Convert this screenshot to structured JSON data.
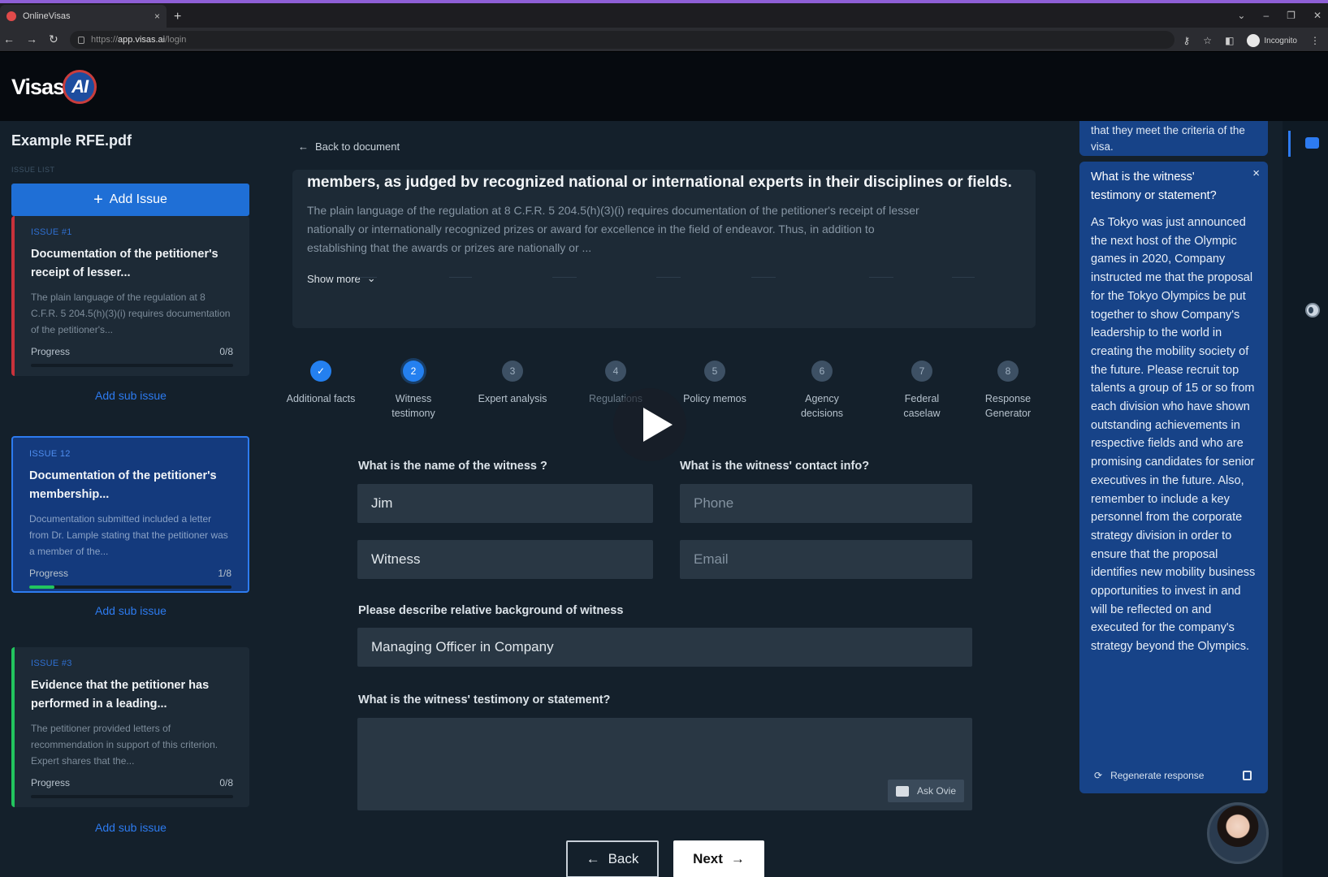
{
  "browser": {
    "tab_title": "OnlineVisas",
    "tab_close": "×",
    "new_tab": "+",
    "url_prefix": "https://",
    "url_host": "app.visas.ai",
    "url_path": "/login",
    "incognito_label": "Incognito"
  },
  "app": {
    "logo_text": "Visas",
    "logo_badge": "AI"
  },
  "sidebar": {
    "doc_name": "Example RFE.pdf",
    "issue_list_label": "ISSUE LIST",
    "add_issue_label": "Add Issue",
    "add_sub_issue_label": "Add sub issue",
    "issues": [
      {
        "label": "ISSUE #1",
        "title": "Documentation of the petitioner's receipt of lesser...",
        "desc": "The plain language of the regulation at 8 C.F.R. 5 204.5(h)(3)(i) requires documentation of the petitioner's...",
        "progress_label": "Progress",
        "progress_value": "0/8",
        "progress_fraction": 0
      },
      {
        "label": "ISSUE 12",
        "title": "Documentation of the petitioner's membership...",
        "desc": "Documentation submitted included a letter from Dr. Lample stating that the petitioner was a member of the...",
        "progress_label": "Progress",
        "progress_value": "1/8",
        "progress_fraction": 0.125
      },
      {
        "label": "ISSUE #3",
        "title": "Evidence that the petitioner has performed in a leading...",
        "desc": "The petitioner provided letters of recommendation in support of this criterion. Expert shares that the...",
        "progress_label": "Progress",
        "progress_value": "0/8",
        "progress_fraction": 0
      }
    ]
  },
  "main": {
    "back_to_document": "Back to document",
    "reg_title": "members, as judged bv recognized national or international experts in their disciplines or fields.",
    "reg_text": "The plain language of the regulation at 8 C.F.R. 5 204.5(h)(3)(i) requires documentation of the petitioner's receipt of lesser nationally or internationally recognized prizes or award for excellence in the field of endeavor. Thus, in addition to establishing that the awards or prizes are nationally or ...",
    "show_more": "Show more",
    "steps": [
      {
        "number": "✓",
        "label": "Additional facts",
        "state": "done"
      },
      {
        "number": "2",
        "label": "Witness testimony",
        "state": "active"
      },
      {
        "number": "3",
        "label": "Expert analysis",
        "state": "todo"
      },
      {
        "number": "4",
        "label": "Regulations",
        "state": "todo"
      },
      {
        "number": "5",
        "label": "Policy memos",
        "state": "todo"
      },
      {
        "number": "6",
        "label": "Agency decisions",
        "state": "todo"
      },
      {
        "number": "7",
        "label": "Federal caselaw",
        "state": "todo"
      },
      {
        "number": "8",
        "label": "Response Generator",
        "state": "todo"
      }
    ],
    "form": {
      "name_question": "What is the name of the witness ?",
      "contact_question": "What is the witness' contact info?",
      "first_name_value": "Jim",
      "last_name_value": "Witness",
      "phone_placeholder": "Phone",
      "email_placeholder": "Email",
      "background_question": "Please describe relative background of witness",
      "background_value": "Managing Officer in Company",
      "testimony_question": "What is the witness' testimony or statement?",
      "ask_button": "Ask Ovie"
    },
    "back_button": "Back",
    "next_button": "Next"
  },
  "chat": {
    "preview_text": "that they meet the criteria of the visa.",
    "question": "What is the witness' testimony or statement?",
    "close": "×",
    "answer": "As Tokyo was just announced the next host of the Olympic games in 2020, Company instructed me that the proposal for the Tokyo Olympics be put together to show Company's leadership to the world in creating the mobility society of the future. Please recruit top talents a group of 15 or so from each division who have shown outstanding achievements in respective fields and who are promising candidates for senior executives in the future. Also, remember to include a key personnel from the corporate strategy division in order to ensure that the proposal identifies new mobility business opportunities to invest in and will be reflected on and executed for the company's strategy beyond the Olympics.",
    "regenerate_label": "Regenerate response"
  },
  "colors": {
    "accent": "#2480f0",
    "issue1_border": "#c8323b",
    "issue3_border": "#22c55e",
    "chat_card": "#174388"
  }
}
